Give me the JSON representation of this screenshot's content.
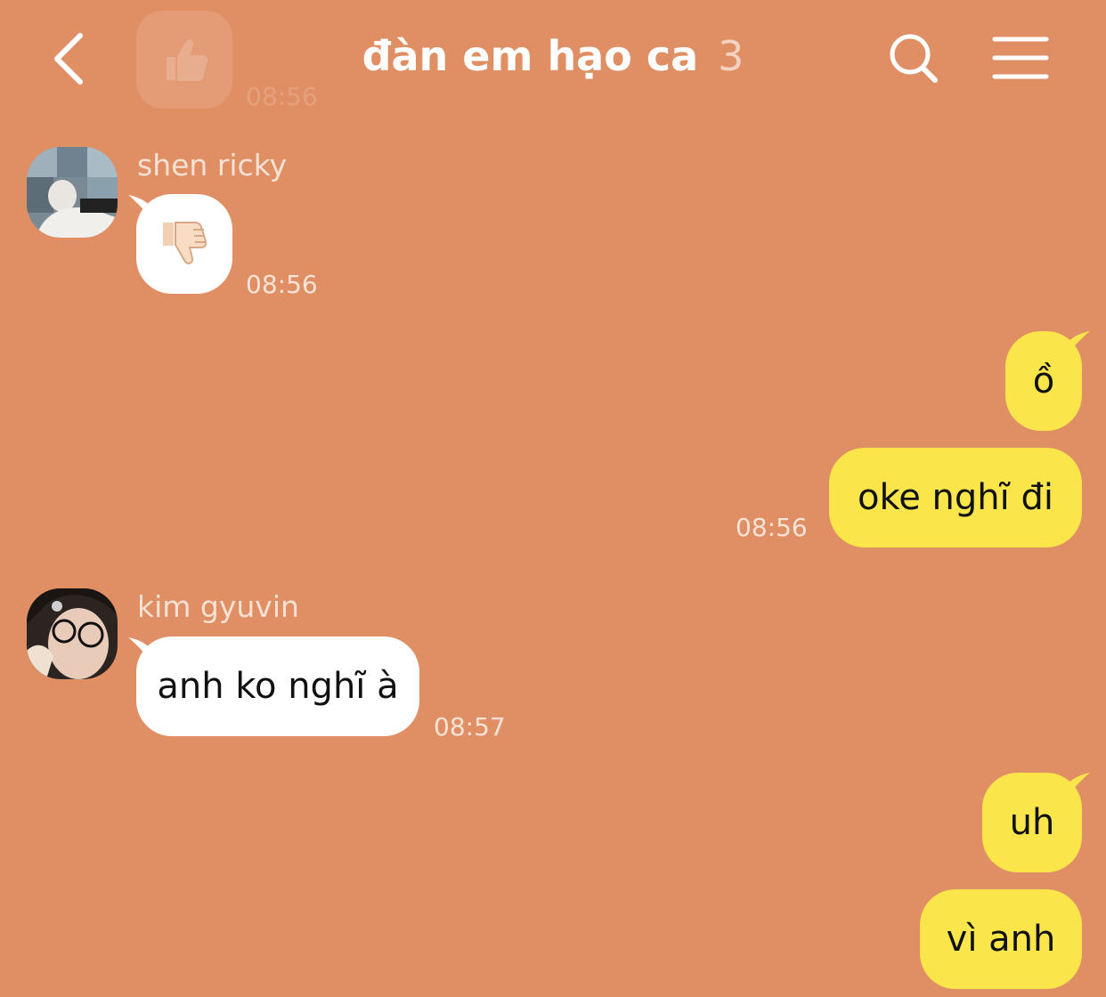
{
  "header": {
    "title": "đàn em hạo ca",
    "member_count": "3",
    "faded_time": "08:56",
    "icons": {
      "back": "chevron-left-icon",
      "search": "search-icon",
      "menu": "menu-icon"
    }
  },
  "messages": [
    {
      "sender": "shen ricky",
      "direction": "incoming",
      "content": "👎",
      "time": "08:56"
    },
    {
      "direction": "outgoing",
      "content": "ồ"
    },
    {
      "direction": "outgoing",
      "content": "oke nghĩ đi",
      "time": "08:56"
    },
    {
      "sender": "kim gyuvin",
      "direction": "incoming",
      "content": "anh ko nghĩ à",
      "time": "08:57"
    },
    {
      "direction": "outgoing",
      "content": "uh"
    },
    {
      "direction": "outgoing",
      "content": "vì anh"
    }
  ],
  "colors": {
    "background": "#E08F64",
    "incoming_bubble": "#FFFFFF",
    "outgoing_bubble": "#FAE54A"
  }
}
